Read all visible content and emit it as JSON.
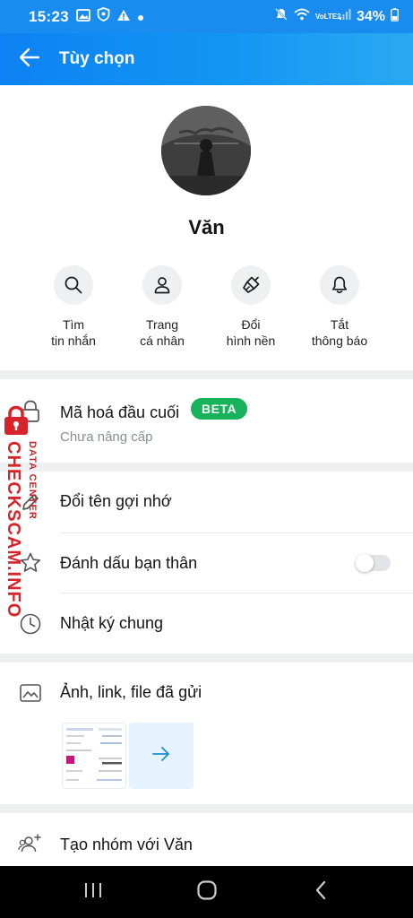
{
  "status_bar": {
    "time": "15:23",
    "battery": "34%",
    "network": "VoLTE2",
    "icons": [
      "image-icon",
      "shield-icon",
      "warning-icon",
      "dot-icon",
      "mute-icon",
      "wifi-icon",
      "signal-icon",
      "battery-icon"
    ]
  },
  "header": {
    "title": "Tùy chọn",
    "back_icon": "arrow-left-icon"
  },
  "profile": {
    "name": "Văn",
    "actions": [
      {
        "label": "Tìm\ntin nhắn",
        "icon": "search-icon"
      },
      {
        "label": "Trang\ncá nhân",
        "icon": "person-icon"
      },
      {
        "label": "Đổi\nhình nền",
        "icon": "paintbrush-icon"
      },
      {
        "label": "Tắt\nthông báo",
        "icon": "bell-icon"
      }
    ]
  },
  "encryption": {
    "label": "Mã hoá đầu cuối",
    "badge": "BETA",
    "status": "Chưa nâng cấp",
    "icon": "lock-icon"
  },
  "options": [
    {
      "label": "Đổi tên gợi nhớ",
      "icon": "pencil-icon"
    },
    {
      "label": "Đánh dấu bạn thân",
      "icon": "star-icon",
      "toggle_on": false
    },
    {
      "label": "Nhật ký chung",
      "icon": "clock-icon"
    }
  ],
  "media": {
    "label": "Ảnh, link, file đã gửi",
    "icon": "photo-icon",
    "more_icon": "arrow-right-icon"
  },
  "create_group": {
    "label": "Tạo nhóm với Văn",
    "icon": "group-add-icon"
  },
  "watermark": {
    "line1": "DATA CENTER",
    "line2": "CHECKSCAM.INFO"
  },
  "colors": {
    "header_blue": "#0d82f4",
    "badge_green": "#16b35a",
    "watermark_red": "#d9232a",
    "link_blue": "#1a8ed3"
  }
}
